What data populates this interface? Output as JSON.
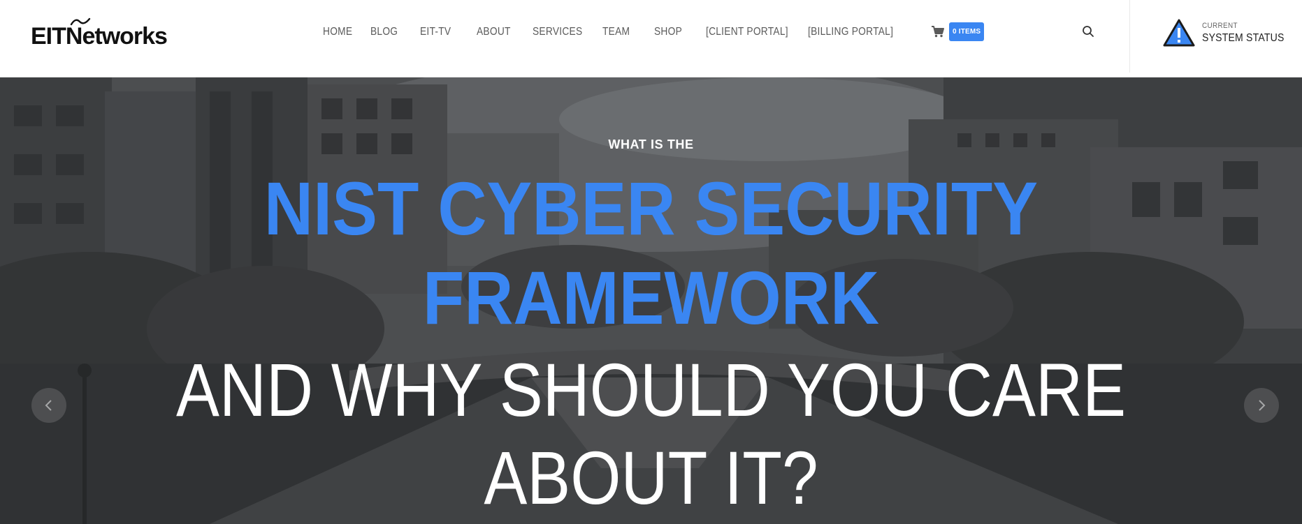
{
  "brand": {
    "logo_text_1": "EIT ",
    "logo_text_n": "N",
    "logo_text_2": "etworks"
  },
  "nav": {
    "items": [
      {
        "label": "HOME"
      },
      {
        "label": "BLOG"
      },
      {
        "label": "EIT-TV"
      },
      {
        "label": "ABOUT"
      },
      {
        "label": "SERVICES"
      },
      {
        "label": "TEAM"
      },
      {
        "label": "SHOP"
      },
      {
        "label": "[CLIENT PORTAL]"
      },
      {
        "label": "[BILLING PORTAL]"
      }
    ],
    "cart_badge": "0 ITEMS",
    "cart_icon": "shopping-cart-icon",
    "search_icon": "search-icon"
  },
  "status": {
    "small_label": "CURRENT",
    "big_label": "SYSTEM STATUS",
    "icon": "warning-triangle-icon"
  },
  "hero": {
    "kicker": "WHAT IS THE",
    "title_line_1": "NIST CYBER SECURITY",
    "title_line_2": "FRAMEWORK",
    "sub_line_1": "AND WHY SHOULD YOU CARE",
    "sub_line_2": "ABOUT IT?",
    "slider_prev_icon": "slider-prev-icon",
    "slider_next_icon": "slider-next-icon"
  },
  "colors": {
    "accent": "#3a86f2",
    "nav_text": "#5a5a5a",
    "header_bg": "#ffffff"
  }
}
